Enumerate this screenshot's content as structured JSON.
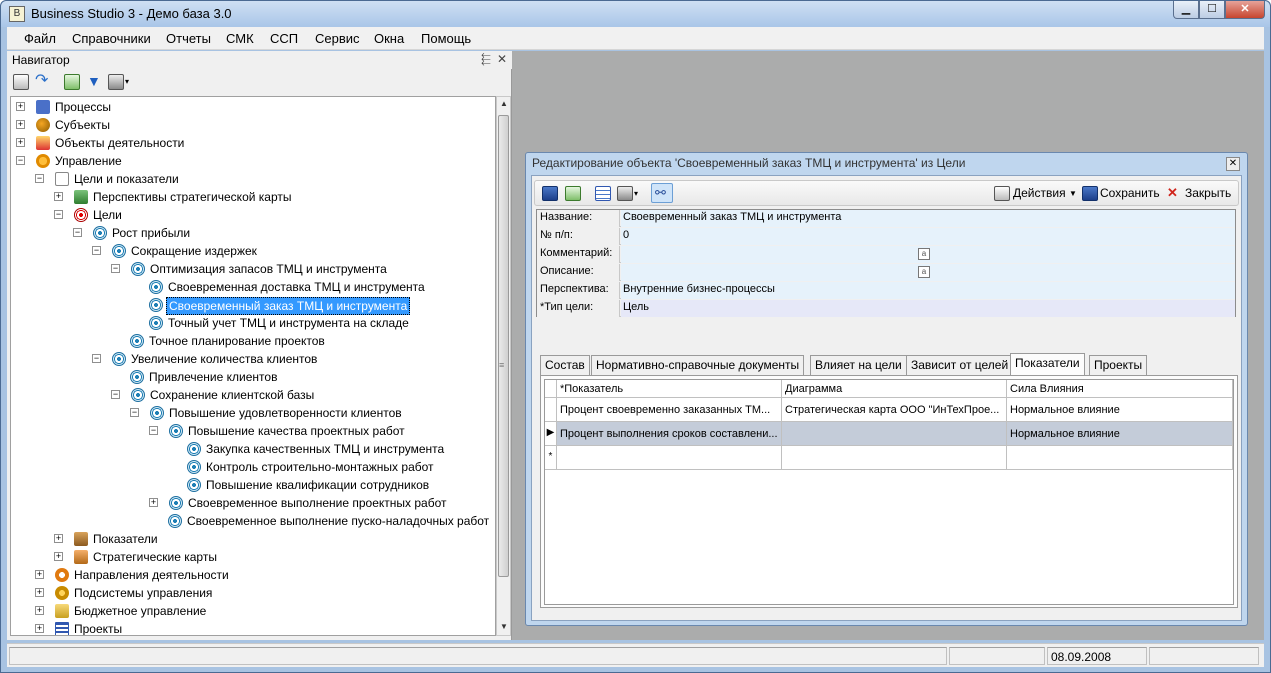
{
  "app": {
    "title": "Business Studio 3 - Демо база 3.0",
    "icon": "app-icon"
  },
  "window_controls": {
    "minimize": "▁",
    "maximize": "☐",
    "close": "✕"
  },
  "menu": [
    "Файл",
    "Справочники",
    "Отчеты",
    "СМК",
    "ССП",
    "Сервис",
    "Окна",
    "Помощь"
  ],
  "navigator": {
    "title": "Навигатор",
    "pin": "📌",
    "close": "✕",
    "toolbar_icons": [
      "edit-icon",
      "refresh-icon",
      "update-icon",
      "filter-icon",
      "print-icon"
    ],
    "tree": [
      {
        "label": "Процессы",
        "icon": "process-icon",
        "expander": "+"
      },
      {
        "label": "Субъекты",
        "icon": "subjects-icon",
        "expander": "+"
      },
      {
        "label": "Объекты деятельности",
        "icon": "objects-icon",
        "expander": "+"
      },
      {
        "label": "Управление",
        "icon": "management-icon",
        "expander": "−"
      },
      {
        "label": "Цели и показатели",
        "icon": "bsc-icon",
        "expander": "−"
      },
      {
        "label": "Перспективы стратегической карты",
        "icon": "perspective-icon",
        "expander": "+"
      },
      {
        "label": "Цели",
        "icon": "target-icon",
        "expander": "−"
      },
      {
        "label": "Рост прибыли",
        "icon": "goal-icon",
        "expander": "−"
      },
      {
        "label": "Сокращение издержек",
        "icon": "goal-icon",
        "expander": "−"
      },
      {
        "label": "Оптимизация запасов ТМЦ и инструмента",
        "icon": "goal-icon",
        "expander": "−"
      },
      {
        "label": "Своевременная доставка ТМЦ и инструмента",
        "icon": "goal-icon",
        "expander": ""
      },
      {
        "label": "Своевременный заказ ТМЦ и инструмента",
        "icon": "goal-icon",
        "expander": "",
        "selected": true
      },
      {
        "label": "Точный учет ТМЦ и инструмента на складе",
        "icon": "goal-icon",
        "expander": ""
      },
      {
        "label": "Точное планирование проектов",
        "icon": "goal-icon",
        "expander": ""
      },
      {
        "label": "Увеличение количества клиентов",
        "icon": "goal-icon",
        "expander": "−"
      },
      {
        "label": "Привлечение клиентов",
        "icon": "goal-icon",
        "expander": ""
      },
      {
        "label": "Сохранение клиентской базы",
        "icon": "goal-icon",
        "expander": "−"
      },
      {
        "label": "Повышение удовлетворенности клиентов",
        "icon": "goal-icon",
        "expander": "−"
      },
      {
        "label": "Повышение качества проектных работ",
        "icon": "goal-icon",
        "expander": "−"
      },
      {
        "label": "Закупка качественных ТМЦ и инструмента",
        "icon": "goal-icon",
        "expander": ""
      },
      {
        "label": "Контроль строительно-монтажных работ",
        "icon": "goal-icon",
        "expander": ""
      },
      {
        "label": "Повышение квалификации сотрудников",
        "icon": "goal-icon",
        "expander": ""
      },
      {
        "label": "Своевременное выполнение проектных работ",
        "icon": "goal-icon",
        "expander": "+"
      },
      {
        "label": "Своевременное выполнение пуско-наладочных работ",
        "icon": "goal-icon",
        "expander": ""
      },
      {
        "label": "Показатели",
        "icon": "indicators-icon",
        "expander": "+"
      },
      {
        "label": "Стратегические карты",
        "icon": "strategy-map-icon",
        "expander": "+"
      },
      {
        "label": "Направления деятельности",
        "icon": "directions-icon",
        "expander": "+"
      },
      {
        "label": "Подсистемы управления",
        "icon": "subsystems-icon",
        "expander": "+"
      },
      {
        "label": "Бюджетное управление",
        "icon": "budget-icon",
        "expander": "+"
      },
      {
        "label": "Проекты",
        "icon": "projects-icon",
        "expander": "+"
      }
    ]
  },
  "editor": {
    "title": "Редактирование объекта 'Своевременный заказ ТМЦ и инструмента' из Цели",
    "close": "✕",
    "toolbar": {
      "actions_label": "Действия",
      "save_label": "Сохранить",
      "close_label": "Закрыть"
    },
    "properties": [
      {
        "key": "Название:",
        "value": "Своевременный заказ ТМЦ и инструмента"
      },
      {
        "key": "№ п/п:",
        "value": "0"
      },
      {
        "key": "Комментарий:",
        "value": ""
      },
      {
        "key": "Описание:",
        "value": ""
      },
      {
        "key": "Перспектива:",
        "value": "Внутренние бизнес-процессы"
      },
      {
        "key": "*Тип цели:",
        "value": "Цель"
      }
    ],
    "tabs": [
      "Состав",
      "Нормативно-справочные документы",
      "Влияет на цели",
      "Зависит от целей",
      "Показатели",
      "Проекты"
    ],
    "active_tab": "Показатели",
    "grid": {
      "columns": [
        "*Показатель",
        "Диаграмма",
        "Сила Влияния"
      ],
      "rows": [
        [
          "Процент своевременно заказанных ТМ...",
          "Стратегическая карта ООО \"ИнТехПрое...",
          "Нормальное влияние"
        ],
        [
          "Процент выполнения сроков составлени...",
          "",
          "Нормальное влияние"
        ]
      ],
      "current_row_marker": "▶",
      "new_row_marker": "*"
    }
  },
  "status_bar": {
    "date": "08.09.2008"
  }
}
